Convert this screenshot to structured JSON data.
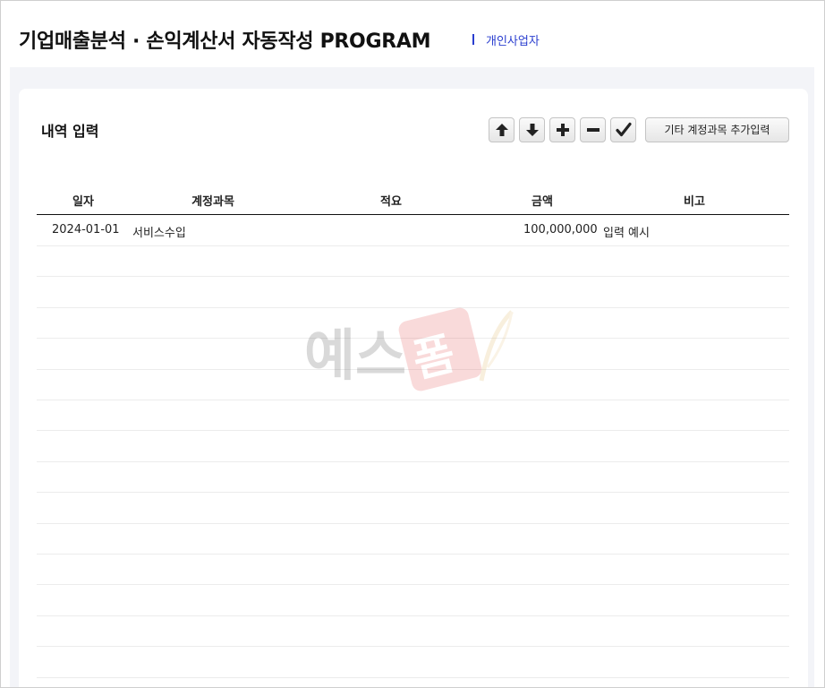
{
  "header": {
    "title": "기업매출분석 · 손익계산서 자동작성 PROGRAM",
    "user_type": "개인사업자"
  },
  "section": {
    "title": "내역 입력",
    "buttons": {
      "move_up": "arrow-up-icon",
      "move_down": "arrow-down-icon",
      "add": "plus-icon",
      "remove": "minus-icon",
      "confirm": "check-icon",
      "extra_accounts_label": "기타 계정과목 추가입력"
    }
  },
  "table": {
    "columns": [
      "일자",
      "계정과목",
      "적요",
      "금액",
      "비고"
    ],
    "rows": [
      {
        "date": "2024-01-01",
        "account": "서비스수입",
        "memo": "",
        "amount": "100,000,000",
        "note": "입력 예시"
      }
    ],
    "empty_rows": 14
  },
  "watermark": {
    "text": "예스폼",
    "brand_color": "#e23a3a"
  },
  "colors": {
    "accent": "#2a3ecf",
    "background": "#f3f4f8"
  }
}
